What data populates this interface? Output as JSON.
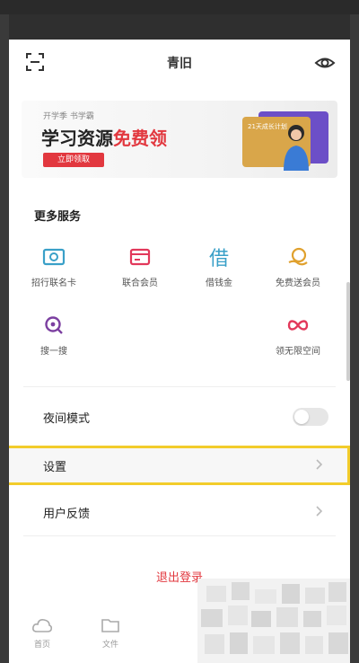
{
  "header": {
    "title": "青旧"
  },
  "banner": {
    "tag": "开学季 书学霸",
    "headline_dark": "学习资源",
    "headline_red": "免费领",
    "cta": "立即领取",
    "card_text": "21天成长计划"
  },
  "services": {
    "title": "更多服务",
    "items": [
      {
        "label": "招行联名卡",
        "icon": "bank-card-icon"
      },
      {
        "label": "联合会员",
        "icon": "member-card-icon"
      },
      {
        "label": "借钱金",
        "icon": "borrow-icon"
      },
      {
        "label": "免费送会员",
        "icon": "gift-icon"
      },
      {
        "label": "搜一搜",
        "icon": "search-icon"
      },
      {
        "label": "领无限空间",
        "icon": "infinity-icon"
      }
    ]
  },
  "settings": {
    "night_mode": "夜间模式",
    "settings": "设置",
    "feedback": "用户反馈",
    "logout": "退出登录"
  },
  "tabbar": {
    "tabs": [
      {
        "label": "首页",
        "icon": "cloud-home-icon"
      },
      {
        "label": "文件",
        "icon": "folder-icon"
      }
    ]
  },
  "colors": {
    "accent_red": "#e2383f",
    "highlight": "#f2cc2b",
    "teal": "#3aa0c8",
    "pink": "#e2385a",
    "purple": "#7b3fa0",
    "orange": "#e0a12e"
  }
}
